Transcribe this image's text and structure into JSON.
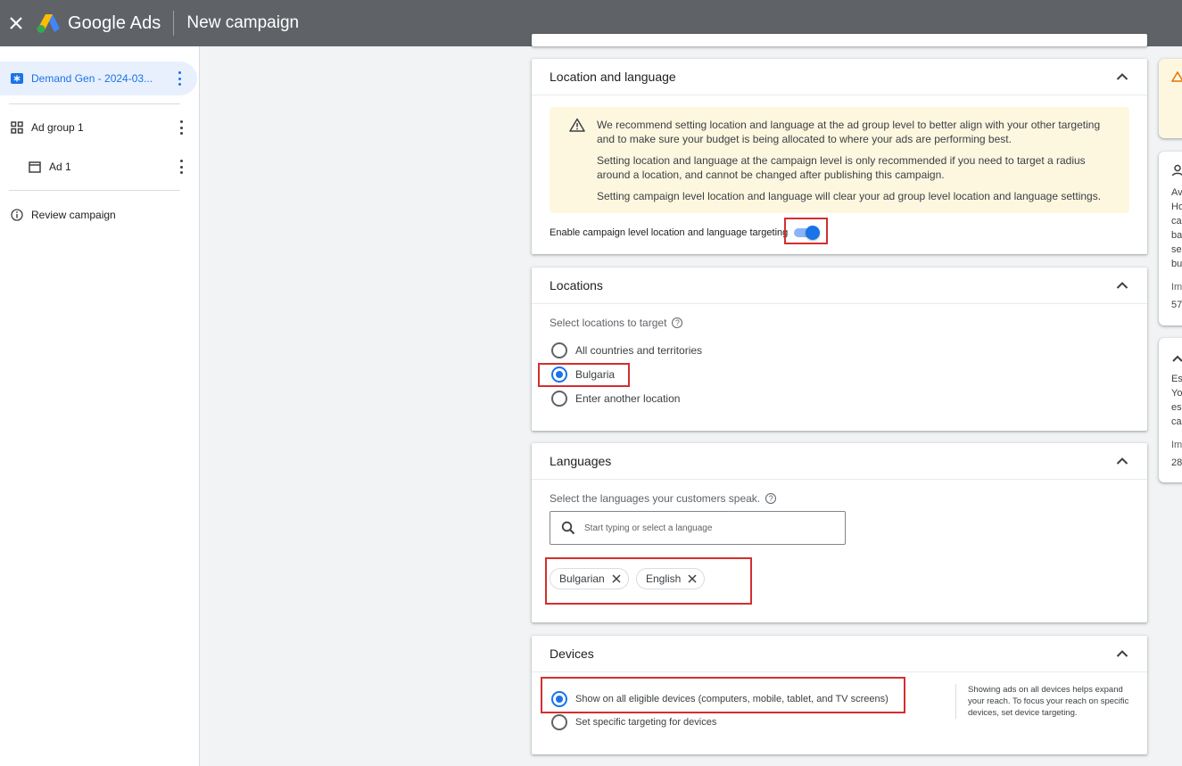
{
  "topbar": {
    "brand": "Google Ads",
    "page_title": "New campaign"
  },
  "sidebar": {
    "items": [
      {
        "label": "Demand Gen - 2024-03..."
      },
      {
        "label": "Ad group 1"
      },
      {
        "label": "Ad 1"
      },
      {
        "label": "Review campaign"
      }
    ]
  },
  "location_language": {
    "title": "Location and language",
    "notice": [
      "We recommend setting location and language at the ad group level to better align with your other targeting and to make sure your budget is being allocated to where your ads are performing best.",
      "Setting location and language at the campaign level is only recommended if you need to target a radius around a location, and cannot be changed after publishing this campaign.",
      "Setting campaign level location and language will clear your ad group level location and language settings."
    ],
    "toggle_label": "Enable campaign level location and language targeting",
    "toggle_on": true
  },
  "locations": {
    "title": "Locations",
    "prompt": "Select locations to target",
    "options": [
      "All countries and territories",
      "Bulgaria",
      "Enter another location"
    ],
    "selected": "Bulgaria"
  },
  "languages": {
    "title": "Languages",
    "prompt": "Select the languages your customers speak.",
    "search_placeholder": "Start typing or select a language",
    "chips": [
      "Bulgarian",
      "English"
    ]
  },
  "devices": {
    "title": "Devices",
    "options": [
      "Show on all eligible devices (computers, mobile, tablet, and TV screens)",
      "Set specific targeting for devices"
    ],
    "selected": "Show on all eligible devices (computers, mobile, tablet, and TV screens)",
    "note": "Showing ads on all devices helps expand your reach. To focus your reach on specific devices, set device targeting."
  },
  "right_panels": {
    "panel1_lines": [
      "Av",
      "Ho",
      "ca",
      "ba",
      "se",
      "bu",
      "Im",
      "57"
    ],
    "panel2_lines": [
      "Es",
      "Yo",
      "es",
      "ca",
      "Im",
      "28"
    ]
  },
  "colors": {
    "accent": "#1a73e8",
    "highlight": "#d32f2f",
    "topbar": "#5f6368",
    "notice_bg": "#fef7e0"
  }
}
